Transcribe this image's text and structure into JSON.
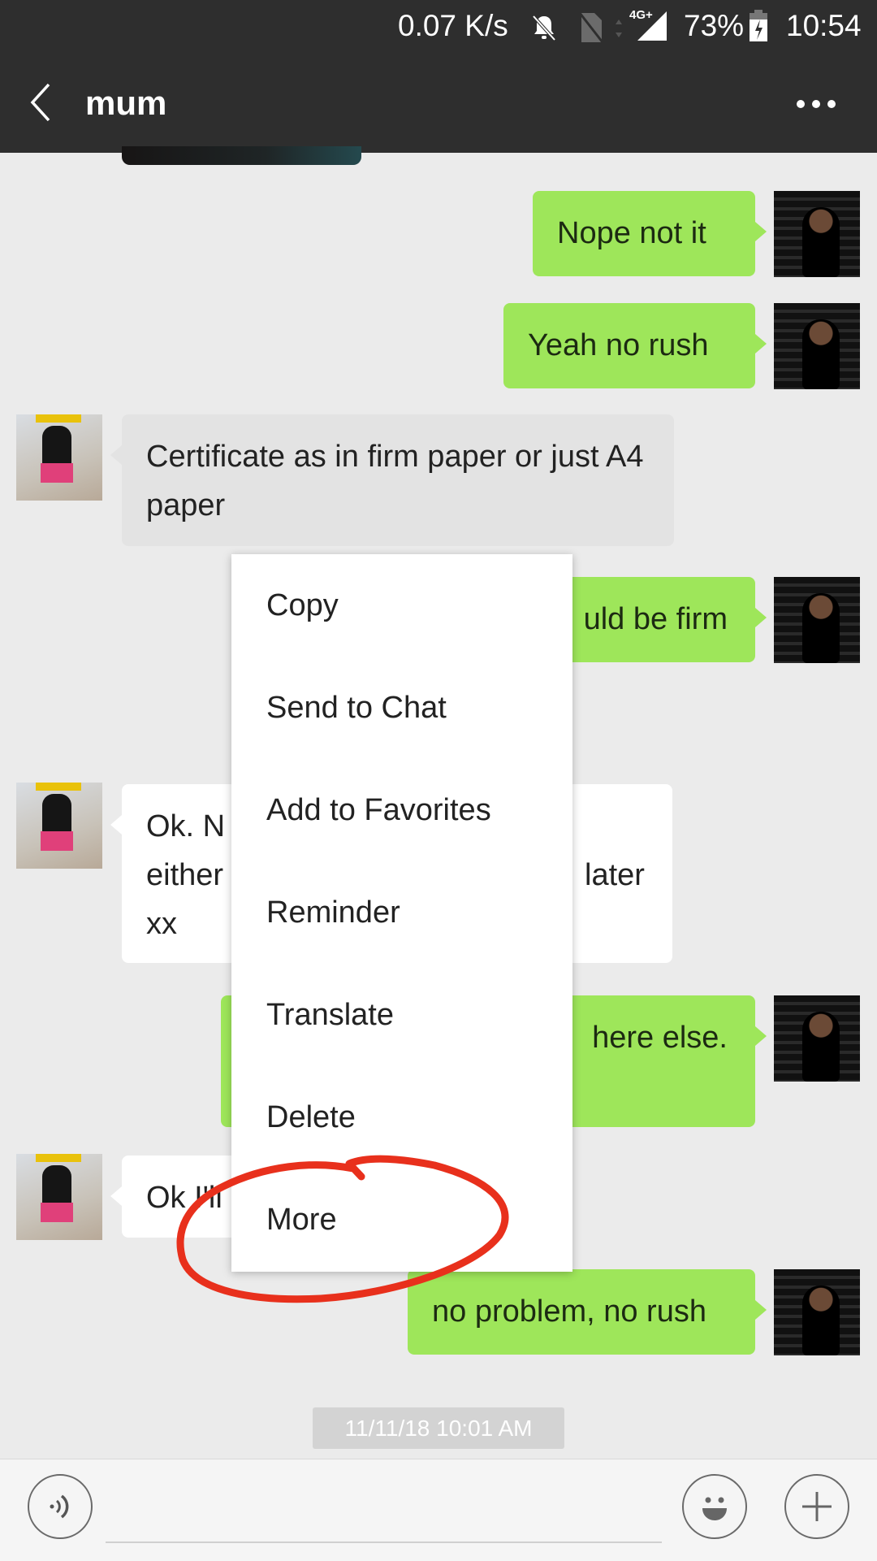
{
  "status_bar": {
    "net_speed": "0.07 K/s",
    "network_type": "4G+",
    "battery": "73%",
    "time": "10:54",
    "icons": [
      "bell-off-icon",
      "no-sim-icon",
      "data-arrows-icon",
      "signal-icon",
      "battery-charging-icon"
    ]
  },
  "header": {
    "back_icon": "chevron-left-icon",
    "title": "mum",
    "more_icon": "more-dots-icon"
  },
  "messages": [
    {
      "from": "me",
      "text": "Nope not it"
    },
    {
      "from": "me",
      "text": "Yeah no rush"
    },
    {
      "from": "mum",
      "text": "Certificate as in firm paper or just A4 paper",
      "selected": true
    },
    {
      "from": "me",
      "text": "uld be firm"
    },
    {
      "from": "mum",
      "text_visible": [
        "Ok. N",
        "either",
        "xx",
        "later"
      ]
    },
    {
      "from": "me",
      "text": "here else."
    },
    {
      "from": "mum",
      "text": "Ok I'll"
    },
    {
      "from": "me",
      "text": "no problem, no rush"
    }
  ],
  "context_menu": {
    "items": [
      {
        "label": "Copy"
      },
      {
        "label": "Send to Chat"
      },
      {
        "label": "Add to Favorites"
      },
      {
        "label": "Reminder"
      },
      {
        "label": "Translate"
      },
      {
        "label": "Delete"
      },
      {
        "label": "More",
        "highlighted": true
      }
    ]
  },
  "timestamp": "11/11/18 10:01 AM",
  "input_bar": {
    "voice_icon": "voice-icon",
    "text_value": "",
    "emoji_icon": "emoji-icon",
    "plus_icon": "plus-icon"
  },
  "colors": {
    "header_bg": "#2e2e2e",
    "sent_bubble": "#9ee65a",
    "received_bubble": "#ffffff",
    "annotation": "#e8301c"
  }
}
